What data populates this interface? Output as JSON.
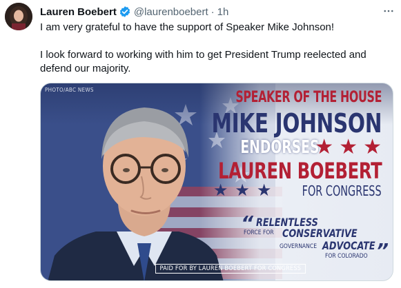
{
  "tweet": {
    "author_name": "Lauren Boebert",
    "handle": "@laurenboebert",
    "separator": "·",
    "timestamp": "1h",
    "verified_icon": "verified-badge-icon",
    "more_icon": "more-options-icon",
    "text_paragraphs": [
      "I am very grateful to have the support of Speaker Mike Johnson!",
      "I look forward to working with him to get President Trump reelected and defend our majority."
    ]
  },
  "media": {
    "photo_credit": "PHOTO/ABC NEWS",
    "headline_line1": "SPEAKER OF THE HOUSE",
    "headline_line2": "MIKE JOHNSON",
    "headline_line3": "ENDORSES",
    "headline_line4": "LAUREN BOEBERT",
    "headline_line5": "FOR CONGRESS",
    "quote_word1": "RELENTLESS",
    "quote_small1": "FORCE FOR",
    "quote_word2": "CONSERVATIVE",
    "quote_small2": "GOVERNANCE",
    "quote_word3": "ADVOCATE",
    "quote_small3": "FOR COLORADO",
    "paid_for": "PAID FOR BY LAUREN BOEBERT FOR CONGRESS"
  },
  "colors": {
    "accent_red": "#b32034",
    "accent_blue": "#2a3570",
    "verified_blue": "#1d9bf0",
    "secondary_text": "#536471"
  }
}
